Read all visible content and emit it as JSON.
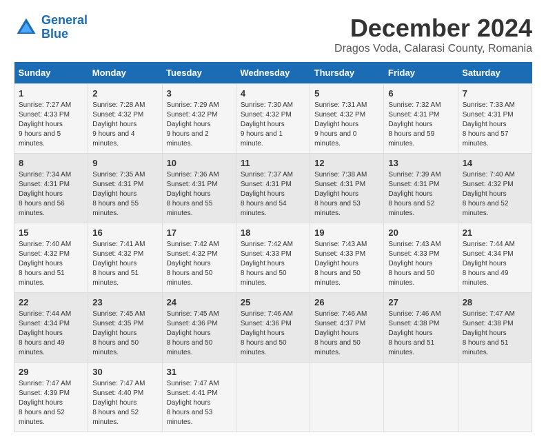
{
  "header": {
    "logo_line1": "General",
    "logo_line2": "Blue",
    "month_title": "December 2024",
    "location": "Dragos Voda, Calarasi County, Romania"
  },
  "weekdays": [
    "Sunday",
    "Monday",
    "Tuesday",
    "Wednesday",
    "Thursday",
    "Friday",
    "Saturday"
  ],
  "weeks": [
    [
      {
        "day": "1",
        "sunrise": "7:27 AM",
        "sunset": "4:33 PM",
        "daylight": "9 hours and 5 minutes."
      },
      {
        "day": "2",
        "sunrise": "7:28 AM",
        "sunset": "4:32 PM",
        "daylight": "9 hours and 4 minutes."
      },
      {
        "day": "3",
        "sunrise": "7:29 AM",
        "sunset": "4:32 PM",
        "daylight": "9 hours and 2 minutes."
      },
      {
        "day": "4",
        "sunrise": "7:30 AM",
        "sunset": "4:32 PM",
        "daylight": "9 hours and 1 minute."
      },
      {
        "day": "5",
        "sunrise": "7:31 AM",
        "sunset": "4:32 PM",
        "daylight": "9 hours and 0 minutes."
      },
      {
        "day": "6",
        "sunrise": "7:32 AM",
        "sunset": "4:31 PM",
        "daylight": "8 hours and 59 minutes."
      },
      {
        "day": "7",
        "sunrise": "7:33 AM",
        "sunset": "4:31 PM",
        "daylight": "8 hours and 57 minutes."
      }
    ],
    [
      {
        "day": "8",
        "sunrise": "7:34 AM",
        "sunset": "4:31 PM",
        "daylight": "8 hours and 56 minutes."
      },
      {
        "day": "9",
        "sunrise": "7:35 AM",
        "sunset": "4:31 PM",
        "daylight": "8 hours and 55 minutes."
      },
      {
        "day": "10",
        "sunrise": "7:36 AM",
        "sunset": "4:31 PM",
        "daylight": "8 hours and 55 minutes."
      },
      {
        "day": "11",
        "sunrise": "7:37 AM",
        "sunset": "4:31 PM",
        "daylight": "8 hours and 54 minutes."
      },
      {
        "day": "12",
        "sunrise": "7:38 AM",
        "sunset": "4:31 PM",
        "daylight": "8 hours and 53 minutes."
      },
      {
        "day": "13",
        "sunrise": "7:39 AM",
        "sunset": "4:31 PM",
        "daylight": "8 hours and 52 minutes."
      },
      {
        "day": "14",
        "sunrise": "7:40 AM",
        "sunset": "4:32 PM",
        "daylight": "8 hours and 52 minutes."
      }
    ],
    [
      {
        "day": "15",
        "sunrise": "7:40 AM",
        "sunset": "4:32 PM",
        "daylight": "8 hours and 51 minutes."
      },
      {
        "day": "16",
        "sunrise": "7:41 AM",
        "sunset": "4:32 PM",
        "daylight": "8 hours and 51 minutes."
      },
      {
        "day": "17",
        "sunrise": "7:42 AM",
        "sunset": "4:32 PM",
        "daylight": "8 hours and 50 minutes."
      },
      {
        "day": "18",
        "sunrise": "7:42 AM",
        "sunset": "4:33 PM",
        "daylight": "8 hours and 50 minutes."
      },
      {
        "day": "19",
        "sunrise": "7:43 AM",
        "sunset": "4:33 PM",
        "daylight": "8 hours and 50 minutes."
      },
      {
        "day": "20",
        "sunrise": "7:43 AM",
        "sunset": "4:33 PM",
        "daylight": "8 hours and 50 minutes."
      },
      {
        "day": "21",
        "sunrise": "7:44 AM",
        "sunset": "4:34 PM",
        "daylight": "8 hours and 49 minutes."
      }
    ],
    [
      {
        "day": "22",
        "sunrise": "7:44 AM",
        "sunset": "4:34 PM",
        "daylight": "8 hours and 49 minutes."
      },
      {
        "day": "23",
        "sunrise": "7:45 AM",
        "sunset": "4:35 PM",
        "daylight": "8 hours and 50 minutes."
      },
      {
        "day": "24",
        "sunrise": "7:45 AM",
        "sunset": "4:36 PM",
        "daylight": "8 hours and 50 minutes."
      },
      {
        "day": "25",
        "sunrise": "7:46 AM",
        "sunset": "4:36 PM",
        "daylight": "8 hours and 50 minutes."
      },
      {
        "day": "26",
        "sunrise": "7:46 AM",
        "sunset": "4:37 PM",
        "daylight": "8 hours and 50 minutes."
      },
      {
        "day": "27",
        "sunrise": "7:46 AM",
        "sunset": "4:38 PM",
        "daylight": "8 hours and 51 minutes."
      },
      {
        "day": "28",
        "sunrise": "7:47 AM",
        "sunset": "4:38 PM",
        "daylight": "8 hours and 51 minutes."
      }
    ],
    [
      {
        "day": "29",
        "sunrise": "7:47 AM",
        "sunset": "4:39 PM",
        "daylight": "8 hours and 52 minutes."
      },
      {
        "day": "30",
        "sunrise": "7:47 AM",
        "sunset": "4:40 PM",
        "daylight": "8 hours and 52 minutes."
      },
      {
        "day": "31",
        "sunrise": "7:47 AM",
        "sunset": "4:41 PM",
        "daylight": "8 hours and 53 minutes."
      },
      null,
      null,
      null,
      null
    ]
  ]
}
